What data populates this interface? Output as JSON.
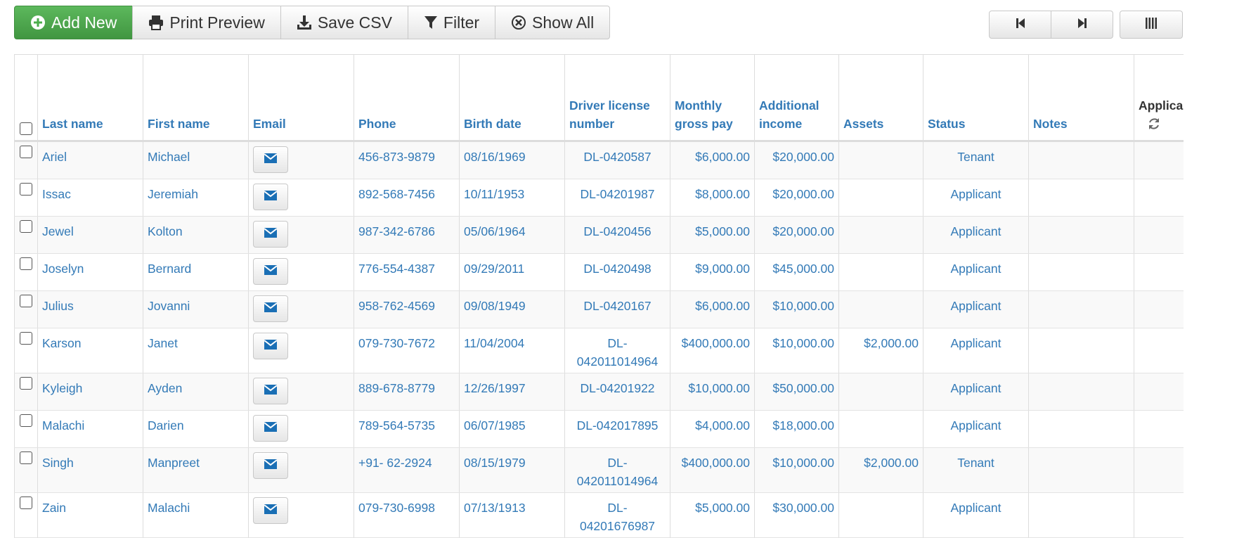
{
  "toolbar": {
    "add_new": "Add New",
    "print_preview": "Print Preview",
    "save_csv": "Save CSV",
    "filter": "Filter",
    "show_all": "Show All"
  },
  "table": {
    "headers": {
      "last_name": "Last name",
      "first_name": "First name",
      "email": "Email",
      "phone": "Phone",
      "birth_date": "Birth date",
      "driver_license": "Driver license number",
      "monthly_gross_pay": "Monthly gross pay",
      "additional_income": "Additional income",
      "assets": "Assets",
      "status": "Status",
      "notes": "Notes",
      "applica": "Applica"
    },
    "rows": [
      {
        "last": "Ariel",
        "first": "Michael",
        "phone": "456-873-9879",
        "birth": "08/16/1969",
        "license": "DL-0420587",
        "pay": "$6,000.00",
        "income": "$20,000.00",
        "assets": "",
        "status": "Tenant",
        "notes": ""
      },
      {
        "last": "Issac",
        "first": "Jeremiah",
        "phone": "892-568-7456",
        "birth": "10/11/1953",
        "license": "DL-04201987",
        "pay": "$8,000.00",
        "income": "$20,000.00",
        "assets": "",
        "status": "Applicant",
        "notes": ""
      },
      {
        "last": "Jewel",
        "first": "Kolton",
        "phone": "987-342-6786",
        "birth": "05/06/1964",
        "license": "DL-0420456",
        "pay": "$5,000.00",
        "income": "$20,000.00",
        "assets": "",
        "status": "Applicant",
        "notes": ""
      },
      {
        "last": "Joselyn",
        "first": "Bernard",
        "phone": "776-554-4387",
        "birth": "09/29/2011",
        "license": "DL-0420498",
        "pay": "$9,000.00",
        "income": "$45,000.00",
        "assets": "",
        "status": "Applicant",
        "notes": ""
      },
      {
        "last": "Julius",
        "first": "Jovanni",
        "phone": "958-762-4569",
        "birth": "09/08/1949",
        "license": "DL-0420167",
        "pay": "$6,000.00",
        "income": "$10,000.00",
        "assets": "",
        "status": "Applicant",
        "notes": ""
      },
      {
        "last": "Karson",
        "first": "Janet",
        "phone": "079-730-7672",
        "birth": "11/04/2004",
        "license": "DL-042011014964",
        "pay": "$400,000.00",
        "income": "$10,000.00",
        "assets": "$2,000.00",
        "status": "Applicant",
        "notes": ""
      },
      {
        "last": "Kyleigh",
        "first": "Ayden",
        "phone": "889-678-8779",
        "birth": "12/26/1997",
        "license": "DL-04201922",
        "pay": "$10,000.00",
        "income": "$50,000.00",
        "assets": "",
        "status": "Applicant",
        "notes": ""
      },
      {
        "last": "Malachi",
        "first": "Darien",
        "phone": "789-564-5735",
        "birth": "06/07/1985",
        "license": "DL-042017895",
        "pay": "$4,000.00",
        "income": "$18,000.00",
        "assets": "",
        "status": "Applicant",
        "notes": ""
      },
      {
        "last": "Singh",
        "first": "Manpreet",
        "phone": "+91- 62-2924",
        "birth": "08/15/1979",
        "license": "DL-042011014964",
        "pay": "$400,000.00",
        "income": "$10,000.00",
        "assets": "$2,000.00",
        "status": "Tenant",
        "notes": ""
      },
      {
        "last": "Zain",
        "first": "Malachi",
        "phone": "079-730-6998",
        "birth": "07/13/1913",
        "license": "DL-04201676987",
        "pay": "$5,000.00",
        "income": "$30,000.00",
        "assets": "",
        "status": "Applicant",
        "notes": ""
      }
    ]
  },
  "icons": {
    "add": "plus-circle-icon",
    "print": "printer-icon",
    "save": "download-icon",
    "filter": "filter-icon",
    "show_all": "close-circle-icon",
    "email": "envelope-icon",
    "first_page": "step-backward-icon",
    "last_page": "step-forward-icon",
    "columns": "columns-icon",
    "refresh": "refresh-icon"
  },
  "colors": {
    "link": "#337ab7",
    "add_button": "#5cb85c"
  }
}
